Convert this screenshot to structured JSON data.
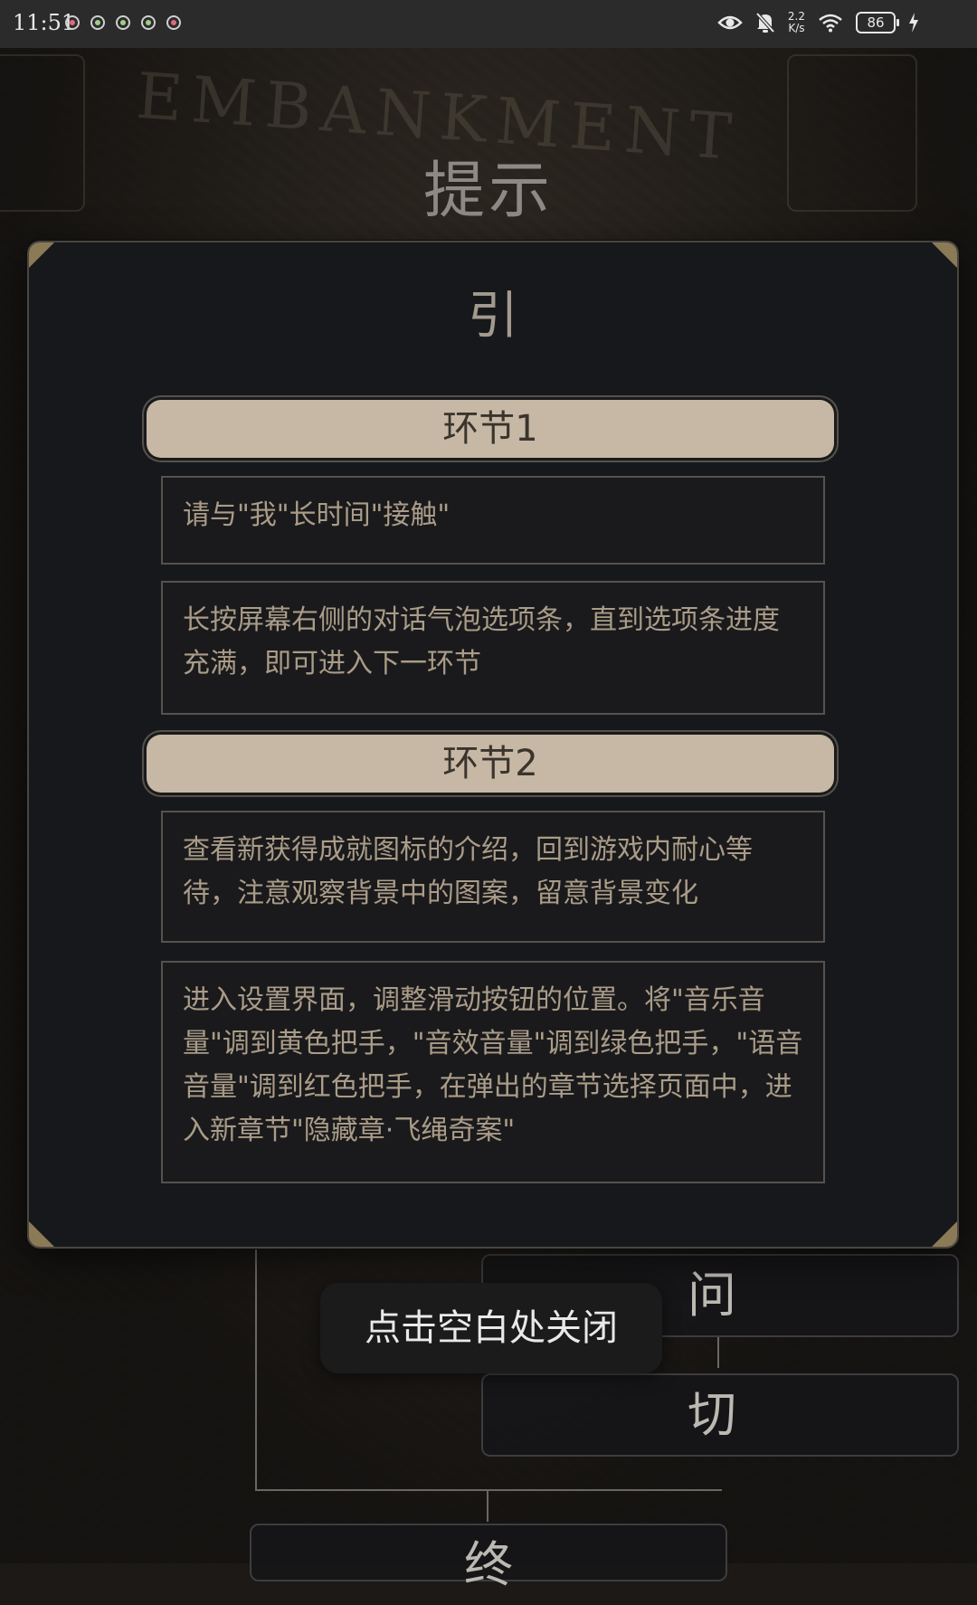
{
  "status_bar": {
    "time": "11:51",
    "net_speed_value": "2.2",
    "net_speed_unit": "K/s",
    "battery": "86"
  },
  "background": {
    "watermark": "EMBANKMENT",
    "nodes": {
      "node_1": "问",
      "node_2": "切",
      "node_3": "终"
    }
  },
  "page_title": "提示",
  "modal": {
    "heading": "引",
    "sections": [
      {
        "label": "环节1",
        "tips": [
          "请与\"我\"长时间\"接触\"",
          "长按屏幕右侧的对话气泡选项条，直到选项条进度充满，即可进入下一环节"
        ]
      },
      {
        "label": "环节2",
        "tips": [
          "查看新获得成就图标的介绍，回到游戏内耐心等待，注意观察背景中的图案，留意背景变化",
          "进入设置界面，调整滑动按钮的位置。将\"音乐音量\"调到黄色把手，\"音效音量\"调到绿色把手，\"语音音量\"调到红色把手，在弹出的章节选择页面中，进入新章节\"隐藏章·飞绳奇案\""
        ]
      }
    ]
  },
  "toast": "点击空白处关闭",
  "colors": {
    "accent_gold": "#8a7a56",
    "pill_bg": "#c6b8a5",
    "tip_text": "#aa9c88"
  }
}
